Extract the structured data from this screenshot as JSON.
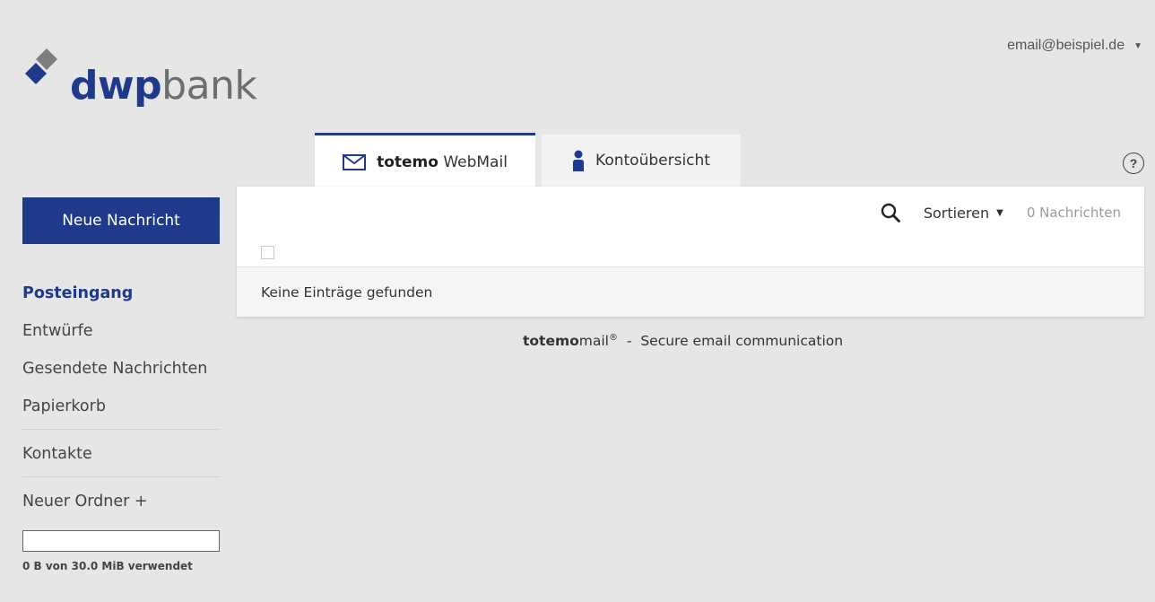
{
  "logo": {
    "text_bold": "dwp",
    "text_light": "bank",
    "brand_color": "#1f3a8a"
  },
  "user_menu": {
    "email": "email@beispiel.de",
    "icon": "caret-down-icon"
  },
  "help": {
    "label": "?"
  },
  "tabs": [
    {
      "brand": "totemo",
      "label": "WebMail",
      "icon": "envelope-icon",
      "active": true
    },
    {
      "label": "Kontoübersicht",
      "icon": "person-icon",
      "active": false
    }
  ],
  "toolbar": {
    "sort_label": "Sortieren",
    "message_count": "0 Nachrichten"
  },
  "list": {
    "empty_text": "Keine Einträge gefunden"
  },
  "footer": {
    "brand_bold": "totemo",
    "brand_light": "mail",
    "registered": "®",
    "separator": "-",
    "tagline": "Secure email communication"
  },
  "sidebar": {
    "new_message_label": "Neue Nachricht",
    "folders": [
      {
        "label": "Posteingang",
        "active": true
      },
      {
        "label": "Entwürfe"
      },
      {
        "label": "Gesendete Nachrichten"
      },
      {
        "label": "Papierkorb"
      }
    ],
    "contacts_label": "Kontakte",
    "new_folder_label": "Neuer Ordner +",
    "quota": {
      "used_fraction": 0,
      "text": "0 B von 30.0 MiB verwendet"
    }
  }
}
